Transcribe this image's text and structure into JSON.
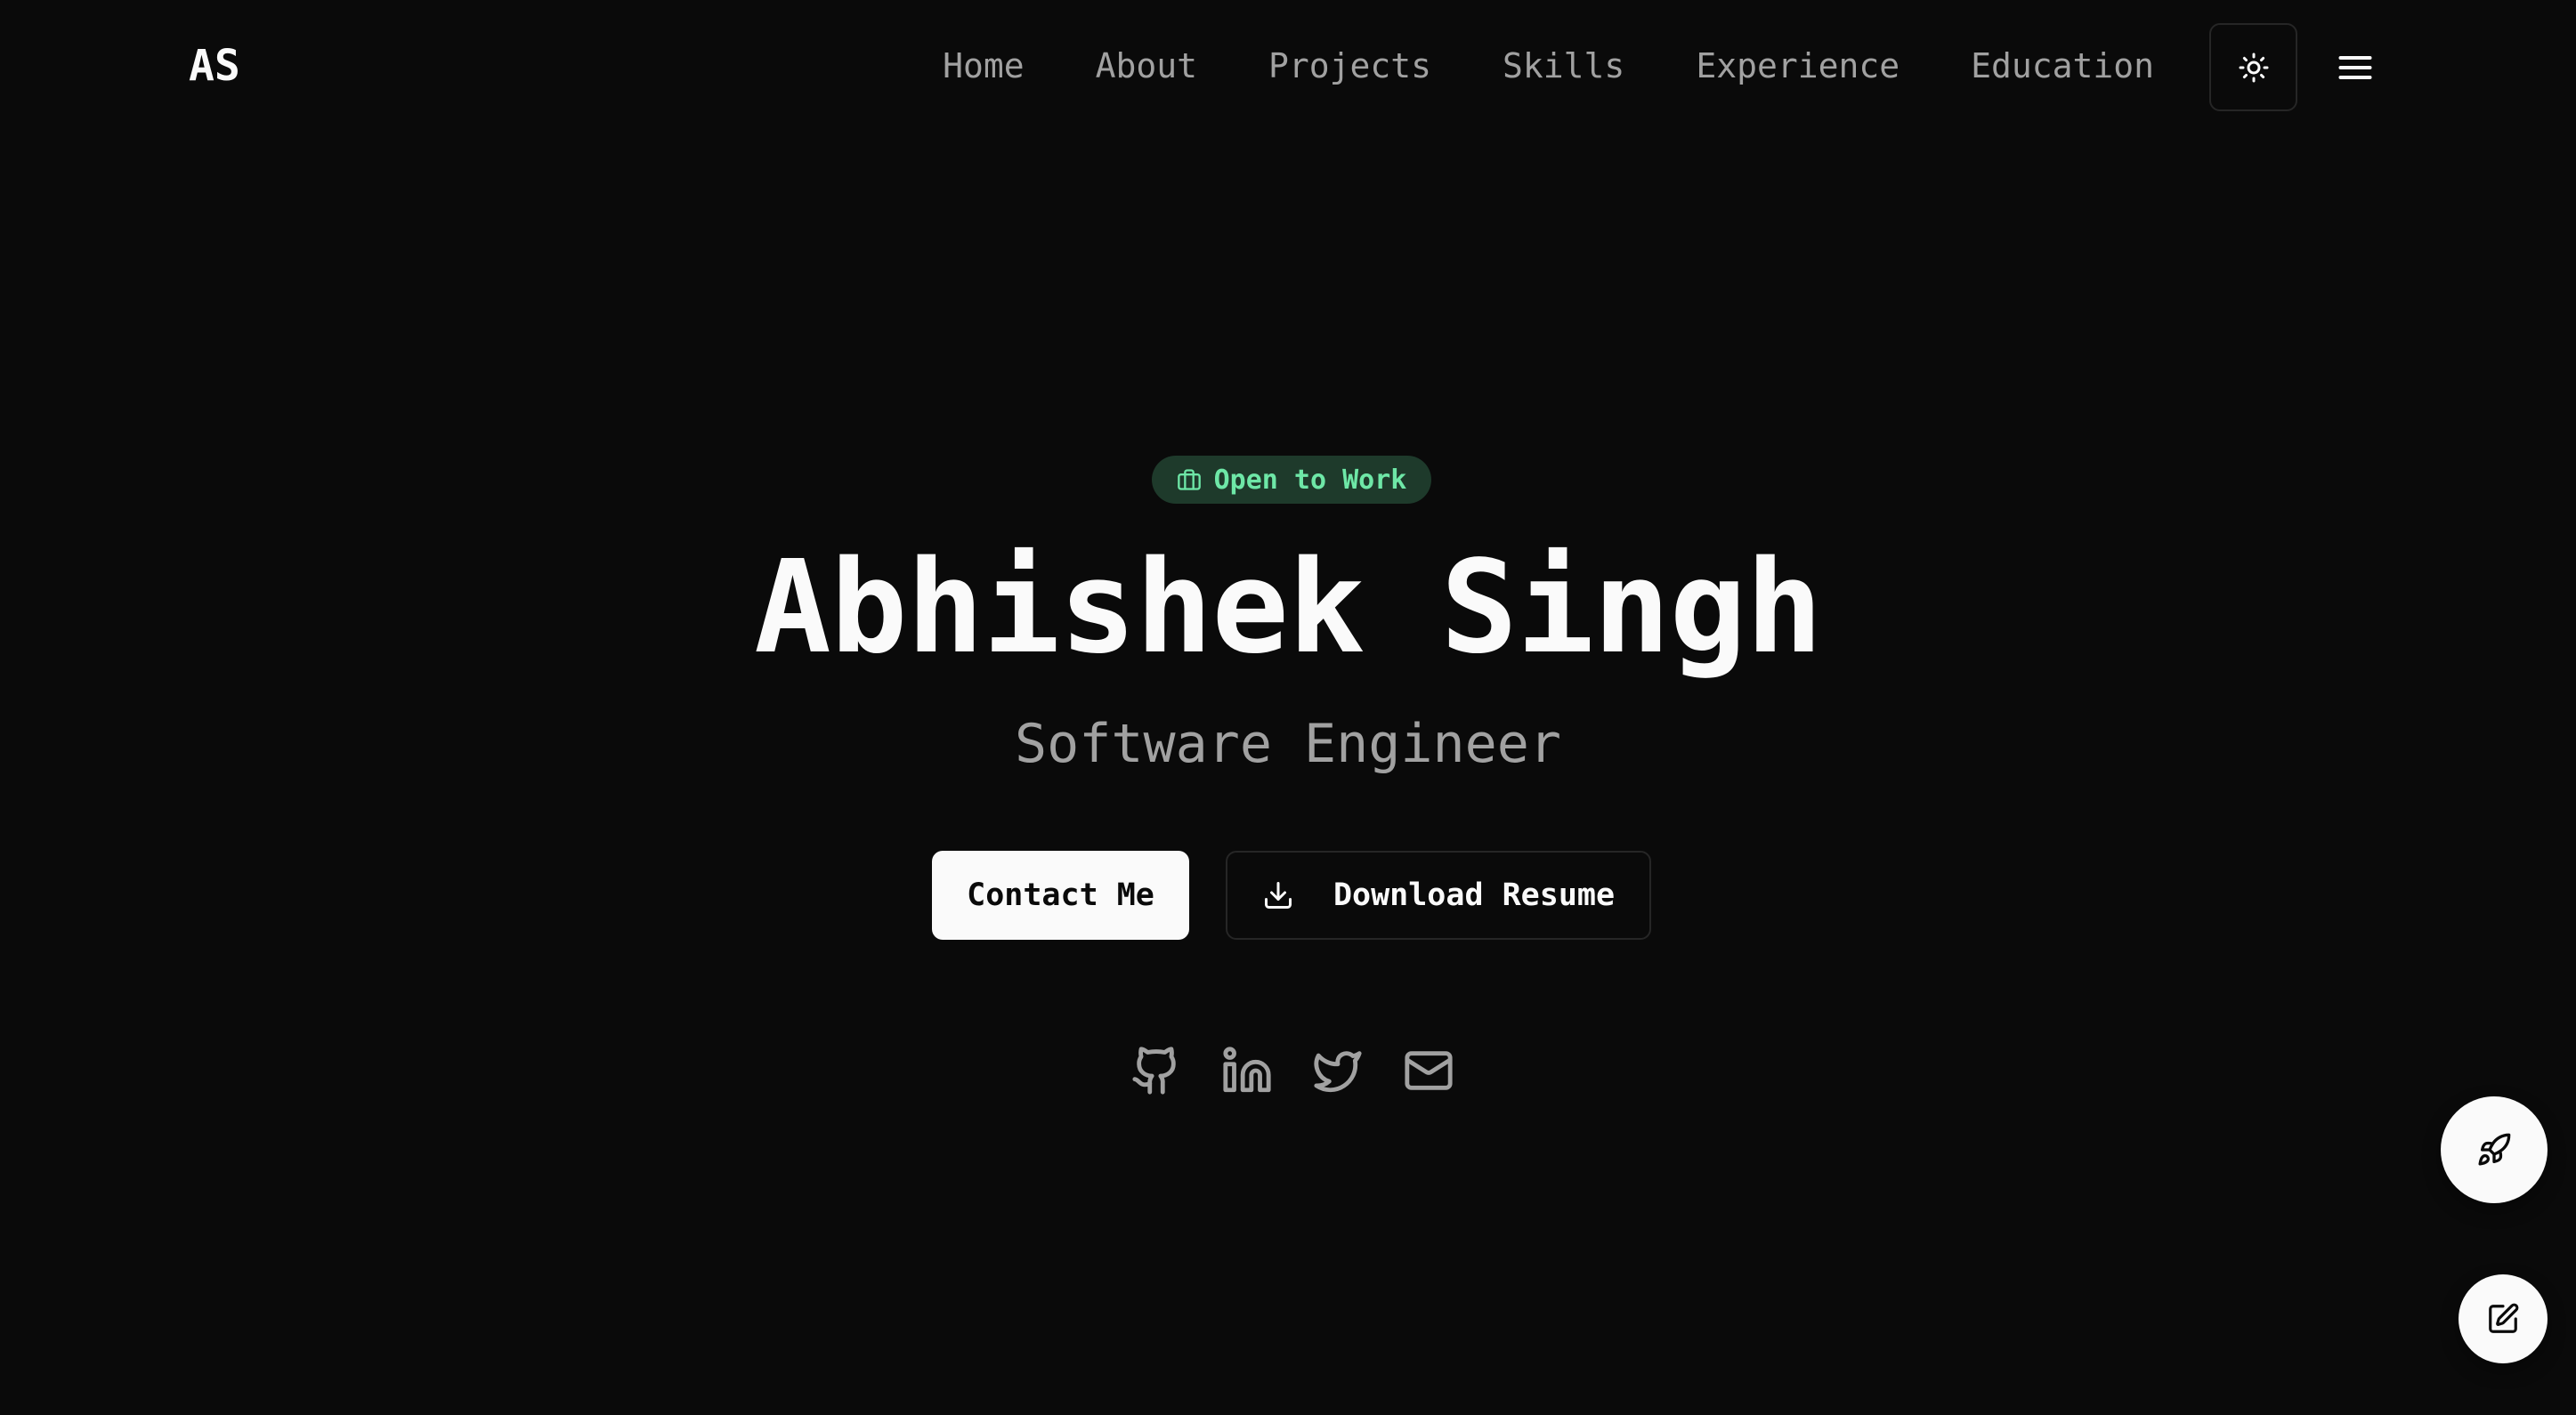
{
  "header": {
    "logo": "AS",
    "nav": [
      {
        "label": "Home"
      },
      {
        "label": "About"
      },
      {
        "label": "Projects"
      },
      {
        "label": "Skills"
      },
      {
        "label": "Experience"
      },
      {
        "label": "Education"
      }
    ],
    "theme_toggle_icon": "sun-icon",
    "menu_icon": "hamburger-menu-icon"
  },
  "hero": {
    "badge": {
      "icon": "briefcase-icon",
      "label": "Open to Work",
      "color": "#6ee7a7",
      "background": "#1e3a2b"
    },
    "name": "Abhishek Singh",
    "role": "Software Engineer",
    "primary_button": "Contact Me",
    "secondary_button": {
      "icon": "download-icon",
      "label": "Download Resume"
    },
    "socials": [
      {
        "icon": "github-icon",
        "name": "GitHub"
      },
      {
        "icon": "linkedin-icon",
        "name": "LinkedIn"
      },
      {
        "icon": "twitter-icon",
        "name": "Twitter"
      },
      {
        "icon": "mail-icon",
        "name": "Email"
      }
    ]
  },
  "floating": {
    "rocket_icon": "rocket-icon",
    "edit_icon": "edit-icon"
  },
  "colors": {
    "background": "#0a0a0a",
    "foreground": "#fafafa",
    "muted": "#a1a1a1",
    "border": "#262626",
    "accent_green": "#6ee7a7"
  }
}
